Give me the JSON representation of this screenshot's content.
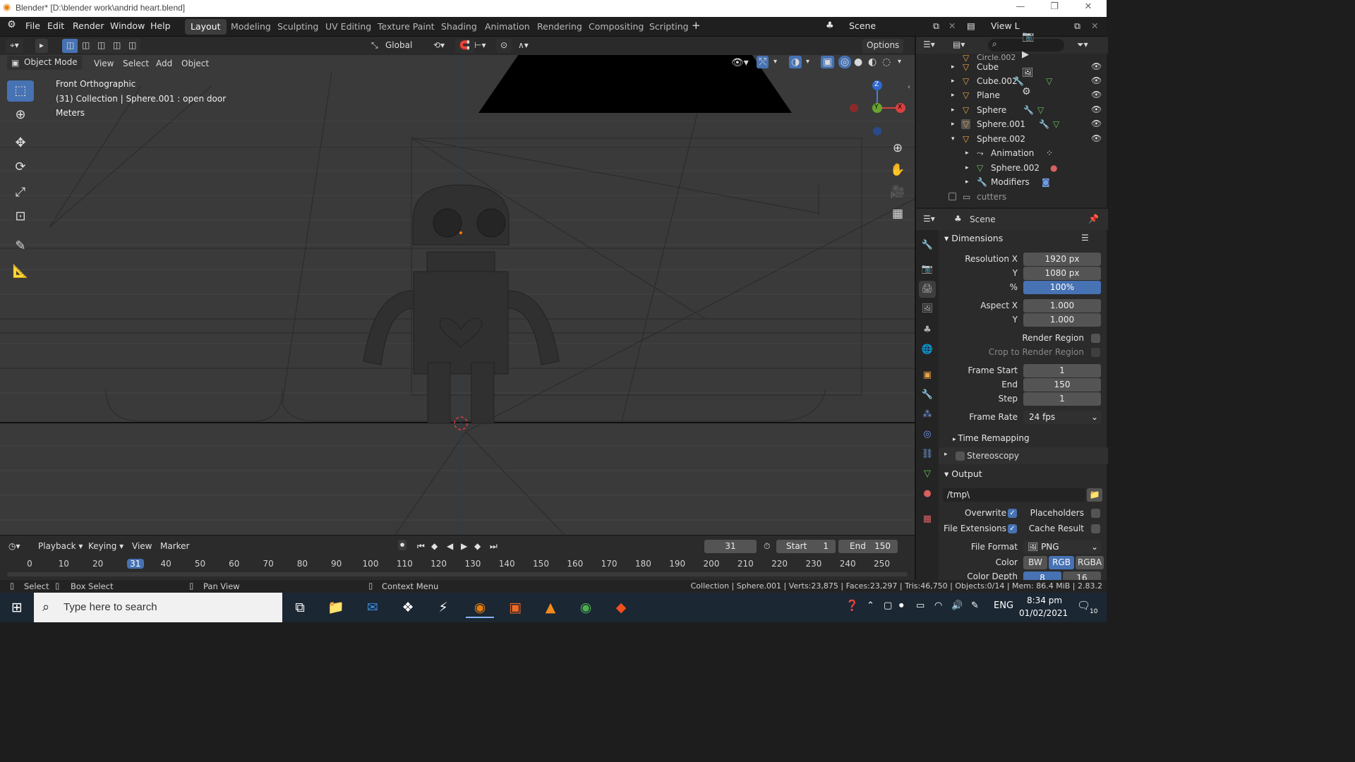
{
  "window": {
    "title": "Blender* [D:\\blender work\\andrid heart.blend]"
  },
  "menu": [
    "File",
    "Edit",
    "Render",
    "Window",
    "Help"
  ],
  "workspaces": [
    "Layout",
    "Modeling",
    "Sculpting",
    "UV Editing",
    "Texture Paint",
    "Shading",
    "Animation",
    "Rendering",
    "Compositing",
    "Scripting"
  ],
  "active_workspace": "Layout",
  "scene_name": "Scene",
  "view_layer": "View L",
  "viewport_header": {
    "orientation": "Global",
    "options": "Options",
    "mode": "Object Mode",
    "menus": [
      "View",
      "Select",
      "Add",
      "Object"
    ]
  },
  "viewport_overlay": {
    "view_name": "Front Orthographic",
    "collection_info": "(31) Collection | Sphere.001 : open door",
    "units": "Meters"
  },
  "gizmo": {
    "z": "Z",
    "y": "Y",
    "x": "X"
  },
  "outliner": {
    "rows": [
      {
        "name": "Circle.002",
        "icon": "mesh-object-icon"
      },
      {
        "name": "Cube",
        "icon": "mesh-object-icon"
      },
      {
        "name": "Cube.002",
        "icon": "mesh-object-icon"
      },
      {
        "name": "Plane",
        "icon": "mesh-object-icon"
      },
      {
        "name": "Sphere",
        "icon": "mesh-object-icon"
      },
      {
        "name": "Sphere.001",
        "icon": "mesh-object-icon"
      },
      {
        "name": "Sphere.002",
        "icon": "mesh-object-icon"
      },
      {
        "name": "Animation",
        "icon": "animation-icon"
      },
      {
        "name": "Sphere.002",
        "icon": "mesh-data-icon"
      },
      {
        "name": "Modifiers",
        "icon": "wrench-icon"
      },
      {
        "name": "cutters",
        "icon": "collection-icon"
      }
    ]
  },
  "properties": {
    "context": "Scene",
    "dimensions": {
      "title": "Dimensions",
      "resolution_x_label": "Resolution X",
      "resolution_x": "1920 px",
      "y_label": "Y",
      "resolution_y": "1080 px",
      "percent_label": "%",
      "percent": "100%",
      "aspect_x_label": "Aspect X",
      "aspect_x": "1.000",
      "aspect_y": "1.000",
      "render_region": "Render Region",
      "crop_region": "Crop to Render Region",
      "frame_start_label": "Frame Start",
      "frame_start": "1",
      "end_label": "End",
      "frame_end": "150",
      "step_label": "Step",
      "step": "1",
      "frame_rate_label": "Frame Rate",
      "frame_rate": "24 fps",
      "time_remapping": "Time Remapping"
    },
    "stereoscopy": "Stereoscopy",
    "output": {
      "title": "Output",
      "path": "/tmp\\",
      "overwrite": "Overwrite",
      "placeholders": "Placeholders",
      "file_extensions": "File Extensions",
      "cache_result": "Cache Result",
      "file_format_label": "File Format",
      "file_format": "PNG",
      "color_label": "Color",
      "color_modes": [
        "BW",
        "RGB",
        "RGBA"
      ],
      "color_depth_label": "Color Depth",
      "color_depths": [
        "8",
        "16"
      ]
    }
  },
  "timeline": {
    "menus": [
      "Playback",
      "Keying",
      "View",
      "Marker"
    ],
    "current_frame": "31",
    "start_label": "Start",
    "start": "1",
    "end_label": "End",
    "end": "150",
    "ticks": [
      "0",
      "10",
      "20",
      "31",
      "40",
      "50",
      "60",
      "70",
      "80",
      "90",
      "100",
      "110",
      "120",
      "130",
      "140",
      "150",
      "160",
      "170",
      "180",
      "190",
      "200",
      "210",
      "220",
      "230",
      "240",
      "250"
    ]
  },
  "statusbar": {
    "select": "Select",
    "box_select": "Box Select",
    "pan_view": "Pan View",
    "context_menu": "Context Menu",
    "stats": "Collection | Sphere.001 | Verts:23,875 | Faces:23,297 | Tris:46,750 | Objects:0/14 | Mem: 86.4 MiB | 2.83.2"
  },
  "taskbar": {
    "search_placeholder": "Type here to search",
    "language": "ENG",
    "time": "8:34 pm",
    "date": "01/02/2021",
    "notifications": "10"
  }
}
